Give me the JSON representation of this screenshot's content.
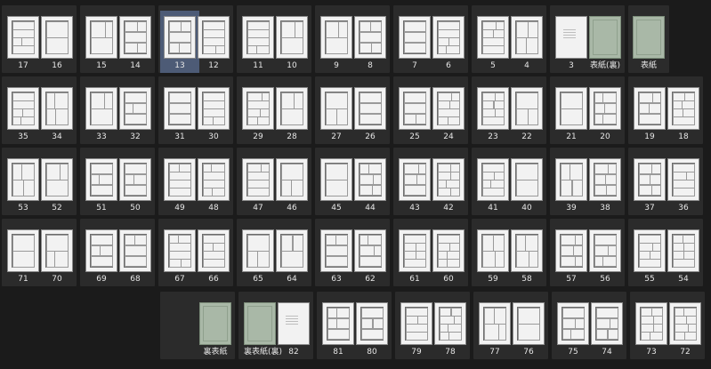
{
  "colors": {
    "background": "#1b1b1b",
    "spread": "#2b2b2b",
    "selected": "#4d5b76",
    "cover": "#a9b8a7"
  },
  "rows": [
    [
      {
        "pages": [
          "17",
          "16"
        ]
      },
      {
        "pages": [
          "15",
          "14"
        ]
      },
      {
        "pages": [
          "13",
          "12"
        ],
        "selected": true
      },
      {
        "pages": [
          "11",
          "10"
        ]
      },
      {
        "pages": [
          "9",
          "8"
        ]
      },
      {
        "pages": [
          "7",
          "6"
        ]
      },
      {
        "pages": [
          "5",
          "4"
        ]
      },
      {
        "pages": [
          "3",
          "表紙(裏)"
        ],
        "covers": [
          false,
          true
        ],
        "text": [
          true,
          false
        ]
      },
      {
        "pages": [
          "",
          "表紙"
        ],
        "covers": [
          false,
          true
        ],
        "single": true
      }
    ],
    [
      {
        "pages": [
          "35",
          "34"
        ]
      },
      {
        "pages": [
          "33",
          "32"
        ]
      },
      {
        "pages": [
          "31",
          "30"
        ]
      },
      {
        "pages": [
          "29",
          "28"
        ]
      },
      {
        "pages": [
          "27",
          "26"
        ]
      },
      {
        "pages": [
          "25",
          "24"
        ]
      },
      {
        "pages": [
          "23",
          "22"
        ]
      },
      {
        "pages": [
          "21",
          "20"
        ]
      },
      {
        "pages": [
          "19",
          "18"
        ]
      }
    ],
    [
      {
        "pages": [
          "53",
          "52"
        ]
      },
      {
        "pages": [
          "51",
          "50"
        ]
      },
      {
        "pages": [
          "49",
          "48"
        ]
      },
      {
        "pages": [
          "47",
          "46"
        ]
      },
      {
        "pages": [
          "45",
          "44"
        ]
      },
      {
        "pages": [
          "43",
          "42"
        ]
      },
      {
        "pages": [
          "41",
          "40"
        ]
      },
      {
        "pages": [
          "39",
          "38"
        ]
      },
      {
        "pages": [
          "37",
          "36"
        ]
      }
    ],
    [
      {
        "pages": [
          "71",
          "70"
        ]
      },
      {
        "pages": [
          "69",
          "68"
        ]
      },
      {
        "pages": [
          "67",
          "66"
        ]
      },
      {
        "pages": [
          "65",
          "64"
        ]
      },
      {
        "pages": [
          "63",
          "62"
        ]
      },
      {
        "pages": [
          "61",
          "60"
        ]
      },
      {
        "pages": [
          "59",
          "58"
        ]
      },
      {
        "pages": [
          "57",
          "56"
        ]
      },
      {
        "pages": [
          "55",
          "54"
        ]
      }
    ],
    [
      {
        "pages": [
          "",
          "裏表紙"
        ],
        "covers": [
          false,
          true
        ],
        "emptyFirst": true
      },
      {
        "pages": [
          "裏表紙(裏)",
          "82"
        ],
        "covers": [
          true,
          false
        ],
        "text": [
          false,
          true
        ]
      },
      {
        "pages": [
          "81",
          "80"
        ]
      },
      {
        "pages": [
          "79",
          "78"
        ]
      },
      {
        "pages": [
          "77",
          "76"
        ]
      },
      {
        "pages": [
          "75",
          "74"
        ]
      },
      {
        "pages": [
          "73",
          "72"
        ]
      }
    ]
  ]
}
